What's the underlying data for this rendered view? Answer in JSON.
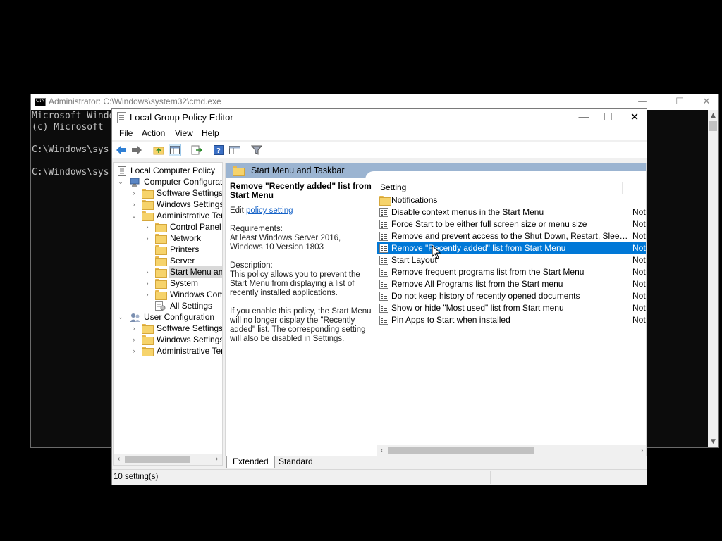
{
  "cmd": {
    "title": "Administrator: C:\\Windows\\system32\\cmd.exe",
    "lines": [
      "Microsoft Windows",
      "(c) Microsoft",
      "",
      "C:\\Windows\\sys",
      "",
      "C:\\Windows\\sys"
    ],
    "buttons": {
      "minimize": "—",
      "maximize": "☐",
      "close": "✕"
    }
  },
  "gpedit": {
    "title": "Local Group Policy Editor",
    "buttons": {
      "minimize": "—",
      "maximize": "☐",
      "close": "✕"
    },
    "menu": [
      "File",
      "Action",
      "View",
      "Help"
    ],
    "tree": {
      "root": "Local Computer Policy",
      "computer_config": "Computer Configuration",
      "cc_software": "Software Settings",
      "cc_windows": "Windows Settings",
      "cc_admin": "Administrative Temp",
      "control_panel": "Control Panel",
      "network": "Network",
      "printers": "Printers",
      "server": "Server",
      "start_menu": "Start Menu and",
      "system": "System",
      "windows_comp": "Windows Comp",
      "all_settings": "All Settings",
      "user_config": "User Configuration",
      "uc_software": "Software Settings",
      "uc_windows": "Windows Settings",
      "uc_admin": "Administrative Tem"
    },
    "header_title": "Start Menu and Taskbar",
    "description": {
      "title": "Remove \"Recently added\" list from Start Menu",
      "edit_prefix": "Edit ",
      "edit_link": "policy setting",
      "requirements_label": "Requirements:",
      "requirements": "At least Windows Server 2016, Windows 10 Version 1803",
      "description_label": "Description:",
      "description_p1": "This policy allows you to prevent the Start Menu from displaying a list of recently installed applications.",
      "description_p2": "If you enable this policy, the Start Menu will no longer display the \"Recently added\" list.  The corresponding setting will also be disabled in Settings."
    },
    "list": {
      "column_setting": "Setting",
      "rows": [
        {
          "name": "Notifications",
          "state": "",
          "type": "folder"
        },
        {
          "name": "Disable context menus in the Start Menu",
          "state": "Not",
          "type": "policy"
        },
        {
          "name": "Force Start to be either full screen size or menu size",
          "state": "Not",
          "type": "policy"
        },
        {
          "name": "Remove and prevent access to the Shut Down, Restart, Sleep, an...",
          "state": "Not",
          "type": "policy"
        },
        {
          "name": "Remove \"Recently added\" list from Start Menu",
          "state": "Not",
          "type": "policy"
        },
        {
          "name": "Start Layout",
          "state": "Not",
          "type": "policy"
        },
        {
          "name": "Remove frequent programs list from the Start Menu",
          "state": "Not",
          "type": "policy"
        },
        {
          "name": "Remove All Programs list from the Start menu",
          "state": "Not",
          "type": "policy"
        },
        {
          "name": "Do not keep history of recently opened documents",
          "state": "Not",
          "type": "policy"
        },
        {
          "name": "Show or hide \"Most used\" list from Start menu",
          "state": "Not",
          "type": "policy"
        },
        {
          "name": "Pin Apps to Start when installed",
          "state": "Not",
          "type": "policy"
        }
      ]
    },
    "tabs": {
      "extended": "Extended",
      "standard": "Standard"
    },
    "status": "10 setting(s)"
  },
  "colors": {
    "selection": "#0078d7",
    "header": "#9bb4d1",
    "link": "#1462c8"
  }
}
